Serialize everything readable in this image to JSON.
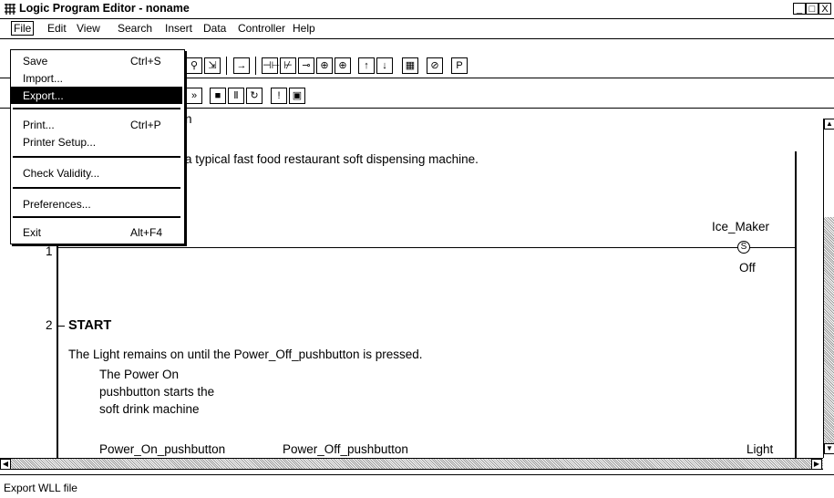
{
  "window": {
    "title": "Logic Program Editor - noname",
    "minimize": "_",
    "maximize": "□",
    "close": "X"
  },
  "menubar": [
    "File",
    "Edit",
    "View",
    "Search",
    "Insert",
    "Data",
    "Controller",
    "Help"
  ],
  "file_menu": {
    "items": [
      {
        "label": "Save",
        "shortcut": "Ctrl+S"
      },
      {
        "label": "Import...",
        "shortcut": ""
      },
      {
        "label": "Export...",
        "shortcut": ""
      },
      {
        "label": "Print...",
        "shortcut": "Ctrl+P"
      },
      {
        "label": "Printer Setup...",
        "shortcut": ""
      },
      {
        "label": "Check Validity...",
        "shortcut": ""
      },
      {
        "label": "Preferences...",
        "shortcut": ""
      },
      {
        "label": "Exit",
        "shortcut": "Alt+F4"
      }
    ],
    "selected": "Export..."
  },
  "editor": {
    "rung1_comment_partial": "n",
    "rung1_desc_partial": "a typical fast food restaurant soft dispensing machine.",
    "rung1_number": "1",
    "coil1_label": "Ice_Maker",
    "coil1_type": "S",
    "coil1_state": "Off",
    "rung2_number": "2",
    "rung2_title": "START",
    "rung2_desc": "The Light remains on until the Power_Off_pushbutton is pressed.",
    "note_lines": [
      "The Power On",
      "pushbutton starts the",
      "soft drink machine"
    ],
    "contact1_label": "Power_On_pushbutton",
    "contact2_label": "Power_Off_pushbutton",
    "coil2_label": "Light"
  },
  "status": {
    "text": "Export WLL file"
  }
}
